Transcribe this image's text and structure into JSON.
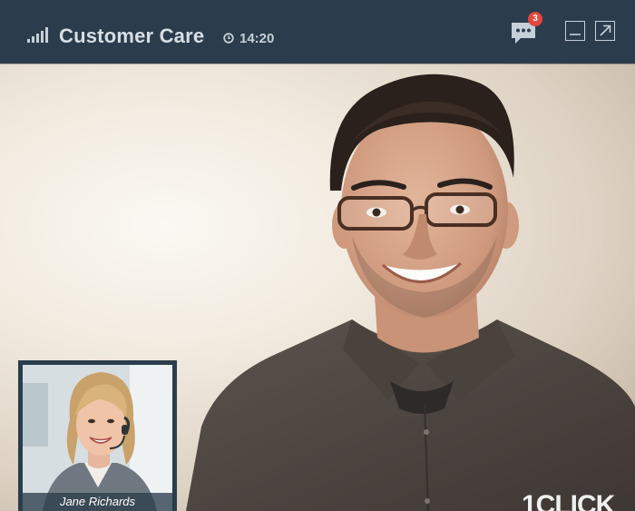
{
  "header": {
    "title": "Customer Care",
    "time": "14:20",
    "signal_icon": "signal-bars-icon",
    "clock_icon": "clock-icon",
    "chat_icon": "chat-bubble-icon",
    "chat_badge_count": "3",
    "minimize_icon": "minimize-icon",
    "expand_icon": "expand-arrow-icon"
  },
  "video": {
    "caller_image": "smiling man with glasses in dark shirt",
    "self_view": {
      "name": "Jane Richards",
      "image": "smiling woman with headset"
    },
    "watermark": "1CLICK"
  },
  "colors": {
    "header_bg": "#2b3d4c",
    "header_text": "#d8dfe5",
    "badge": "#e4463f"
  }
}
